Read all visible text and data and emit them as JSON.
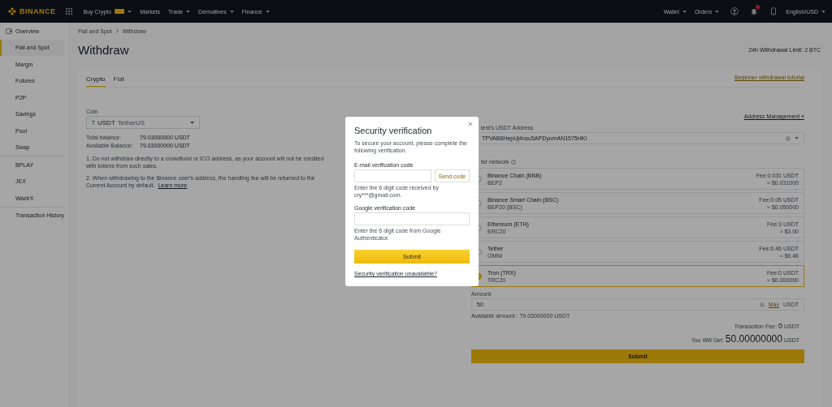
{
  "header": {
    "logo": "BINANCE",
    "nav": [
      {
        "label": "Buy Crypto",
        "badge": true,
        "dropdown": true
      },
      {
        "label": "Markets",
        "badge": false,
        "dropdown": false
      },
      {
        "label": "Trade",
        "badge": false,
        "dropdown": true
      },
      {
        "label": "Derivatives",
        "badge": false,
        "dropdown": true
      },
      {
        "label": "Finance",
        "badge": false,
        "dropdown": true
      }
    ],
    "right": [
      {
        "label": "Wallet"
      },
      {
        "label": "Orders"
      }
    ],
    "locale": "English/USD"
  },
  "sidebar": {
    "groups": [
      [
        {
          "label": "Overview",
          "selected": false
        },
        {
          "label": "Fiat and Spot",
          "selected": true
        },
        {
          "label": "Margin",
          "selected": false
        },
        {
          "label": "Futures",
          "selected": false
        },
        {
          "label": "P2P",
          "selected": false
        },
        {
          "label": "Savings",
          "selected": false
        },
        {
          "label": "Pool",
          "selected": false
        },
        {
          "label": "Swap",
          "selected": false
        }
      ],
      [
        {
          "label": "BPLAY",
          "selected": false
        },
        {
          "label": "JEX",
          "selected": false
        },
        {
          "label": "WazirX",
          "selected": false
        }
      ],
      [
        {
          "label": "Transaction History",
          "selected": false
        }
      ]
    ]
  },
  "breadcrumb": [
    "Fiat and Spot",
    "Withdraw"
  ],
  "title": "Withdraw",
  "limit": "24h Withdrawal Limit: 2 BTC",
  "tabs": [
    {
      "label": "Crypto",
      "selected": true
    },
    {
      "label": "Fiat",
      "selected": false
    }
  ],
  "coin": {
    "label": "Coin",
    "symbol": "USDT",
    "name": "TetherUS"
  },
  "balances": [
    {
      "label": "Total balance:",
      "value": "79.03000000 USDT"
    },
    {
      "label": "Available Balance:",
      "value": "79.03000000 USDT"
    }
  ],
  "notes": [
    "1. Do not withdraw directly to a crowdfund or ICO address, as your account will not be credited with tokens from such sales.",
    "2. When withdrawing to the Binance user's address, the handling fee will be returned to the Current Account by default."
  ],
  "learn_more": "Learn more",
  "tutorial_link": "Beginner withdrawal tutorial",
  "address_link": "Address Management »",
  "address": {
    "label": "ient's USDT Address",
    "value": "TPVAB6HepUj4nsu5APDyumAN1575HKi"
  },
  "network_label": "fer network",
  "networks": [
    {
      "name": "Binance Chain (BNB)",
      "code": "BEP2",
      "fee": "Fee:0.031 USDT",
      "approx": "≈ $0.031000",
      "selected": false
    },
    {
      "name": "Binance Smart Chain (BSC)",
      "code": "BEP20 (BSC)",
      "fee": "Fee:0.05 USDT",
      "approx": "≈ $0.050000",
      "selected": false
    },
    {
      "name": "Ethereum (ETH)",
      "code": "ERC20",
      "fee": "Fee:3 USDT",
      "approx": "≈ $3.00",
      "selected": false
    },
    {
      "name": "Tether",
      "code": "OMNI",
      "fee": "Fee:6.46 USDT",
      "approx": "≈ $6.46",
      "selected": false
    },
    {
      "name": "Tron (TRX)",
      "code": "TRC20",
      "fee": "Fee:0 USDT",
      "approx": "≈ $0.000000",
      "selected": true
    }
  ],
  "amount": {
    "label": "Amount",
    "value": "50",
    "max": "Max",
    "unit": "USDT"
  },
  "available": "Available amount : 79.03000000 USDT",
  "fee": {
    "label": "Transaction Fee:",
    "value": "0",
    "unit": "USDT"
  },
  "get": {
    "label": "You Will Get:",
    "value": "50.00000000",
    "unit": "USDT"
  },
  "submit": "Submit",
  "modal": {
    "title": "Security verification",
    "description": "To secure your account, please complete the following verification.",
    "email_label": "E-mail verification code",
    "send": "Send code",
    "email_hint": "Enter the 6 digit code received by cry***@gmail.com.",
    "google_label": "Google verification code",
    "google_hint": "Enter the 6 digit code from Google Authenticator.",
    "submit": "Submit",
    "link": "Security verification unavailable?"
  }
}
